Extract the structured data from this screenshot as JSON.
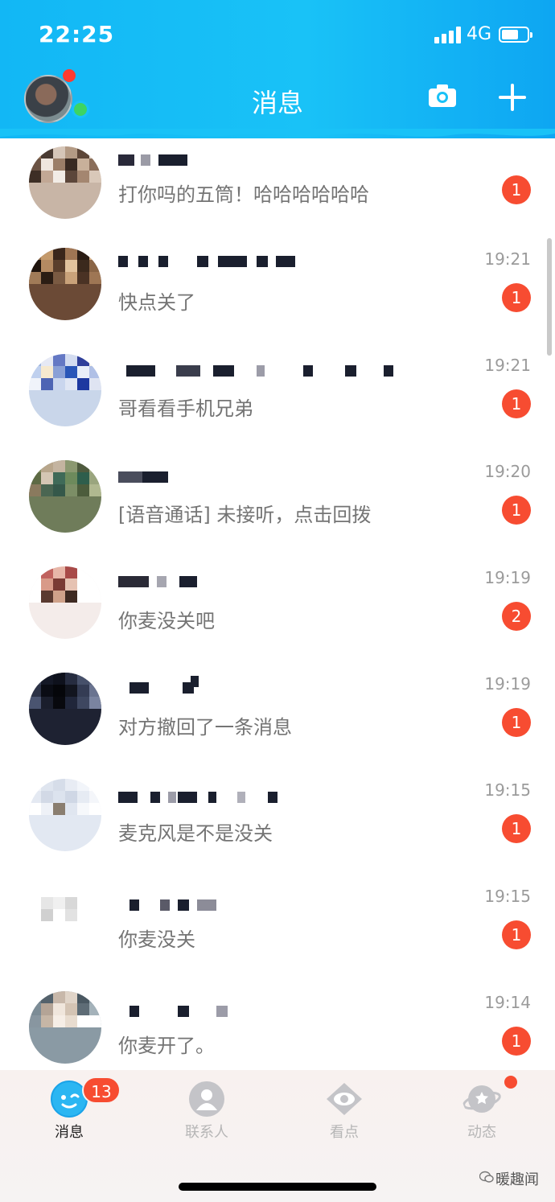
{
  "status": {
    "time": "22:25",
    "network": "4G"
  },
  "header": {
    "title": "消息",
    "camera_icon": "camera-icon",
    "add_icon": "plus-icon"
  },
  "colors": {
    "header": "#19c2f7",
    "badge": "#f74c31",
    "online": "#3dd463"
  },
  "conversations": [
    {
      "time": "",
      "preview": "打你吗的五筒！哈哈哈哈哈哈",
      "unread": "1"
    },
    {
      "time": "19:21",
      "preview": "快点关了",
      "unread": "1"
    },
    {
      "time": "19:21",
      "preview": "哥看看手机兄弟",
      "unread": "1"
    },
    {
      "time": "19:20",
      "preview": "[语音通话] 未接听，点击回拨",
      "unread": "1"
    },
    {
      "time": "19:19",
      "preview": "你麦没关吧",
      "unread": "2"
    },
    {
      "time": "19:19",
      "preview": "对方撤回了一条消息",
      "unread": "1"
    },
    {
      "time": "19:15",
      "preview": "麦克风是不是没关",
      "unread": "1"
    },
    {
      "time": "19:15",
      "preview": "你麦没关",
      "unread": "1"
    },
    {
      "time": "19:14",
      "preview": "你麦开了。",
      "unread": "1"
    }
  ],
  "tabbar": {
    "tabs": [
      {
        "label": "消息",
        "icon": "chat-bubble-icon",
        "badge": "13"
      },
      {
        "label": "联系人",
        "icon": "contact-person-icon"
      },
      {
        "label": "看点",
        "icon": "eye-icon"
      },
      {
        "label": "动态",
        "icon": "planet-icon"
      }
    ]
  },
  "watermark": "暖趣闻"
}
